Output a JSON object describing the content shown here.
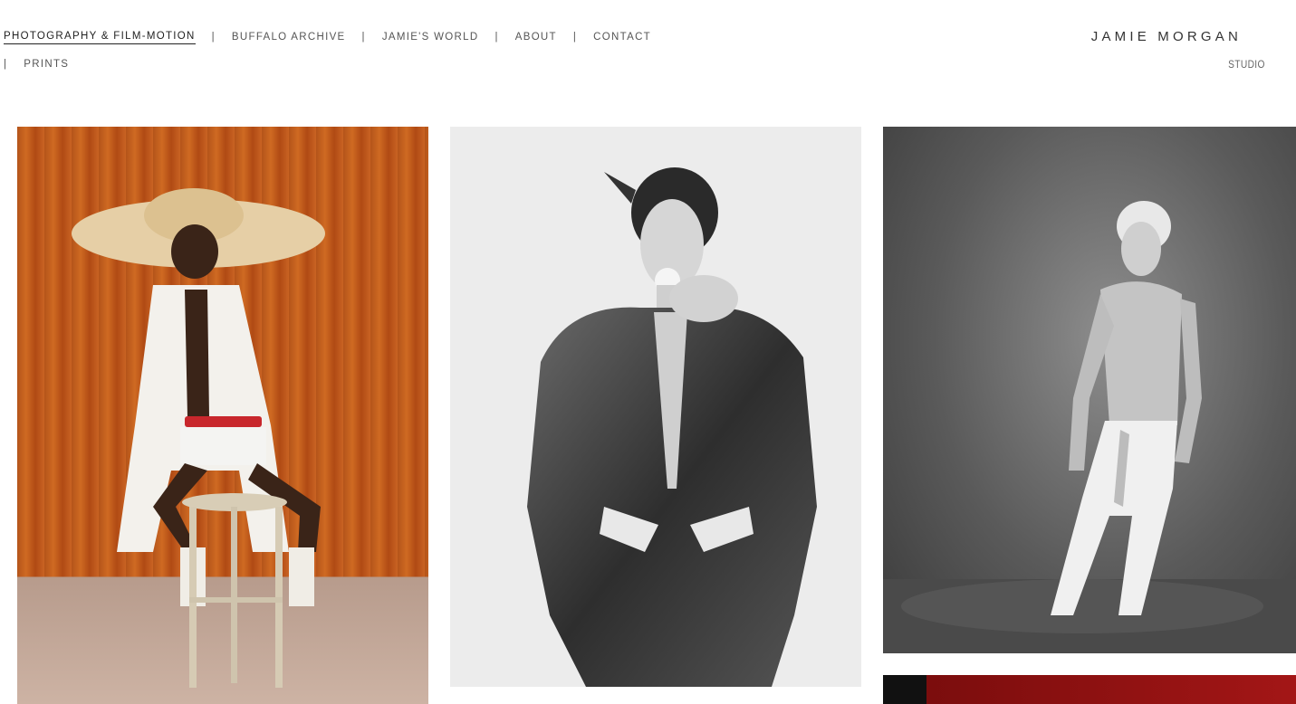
{
  "nav": {
    "items": [
      {
        "label": "PHOTOGRAPHY & FILM-MOTION",
        "active": true
      },
      {
        "label": "BUFFALO ARCHIVE"
      },
      {
        "label": "JAMIE'S WORLD"
      },
      {
        "label": "ABOUT"
      },
      {
        "label": "CONTACT"
      },
      {
        "label": "PRINTS"
      }
    ],
    "separator": "|"
  },
  "brand": {
    "name": "JAMIE MORGAN",
    "sub": "STUDIO"
  },
  "gallery": {
    "tiles": [
      {
        "subject": "model-in-white-shirt-and-straw-hat-on-stool"
      },
      {
        "subject": "model-in-fur-jacket-with-flower"
      },
      {
        "subject": "shirtless-model-in-white-trousers"
      },
      {
        "subject": "red-backdrop"
      }
    ]
  }
}
